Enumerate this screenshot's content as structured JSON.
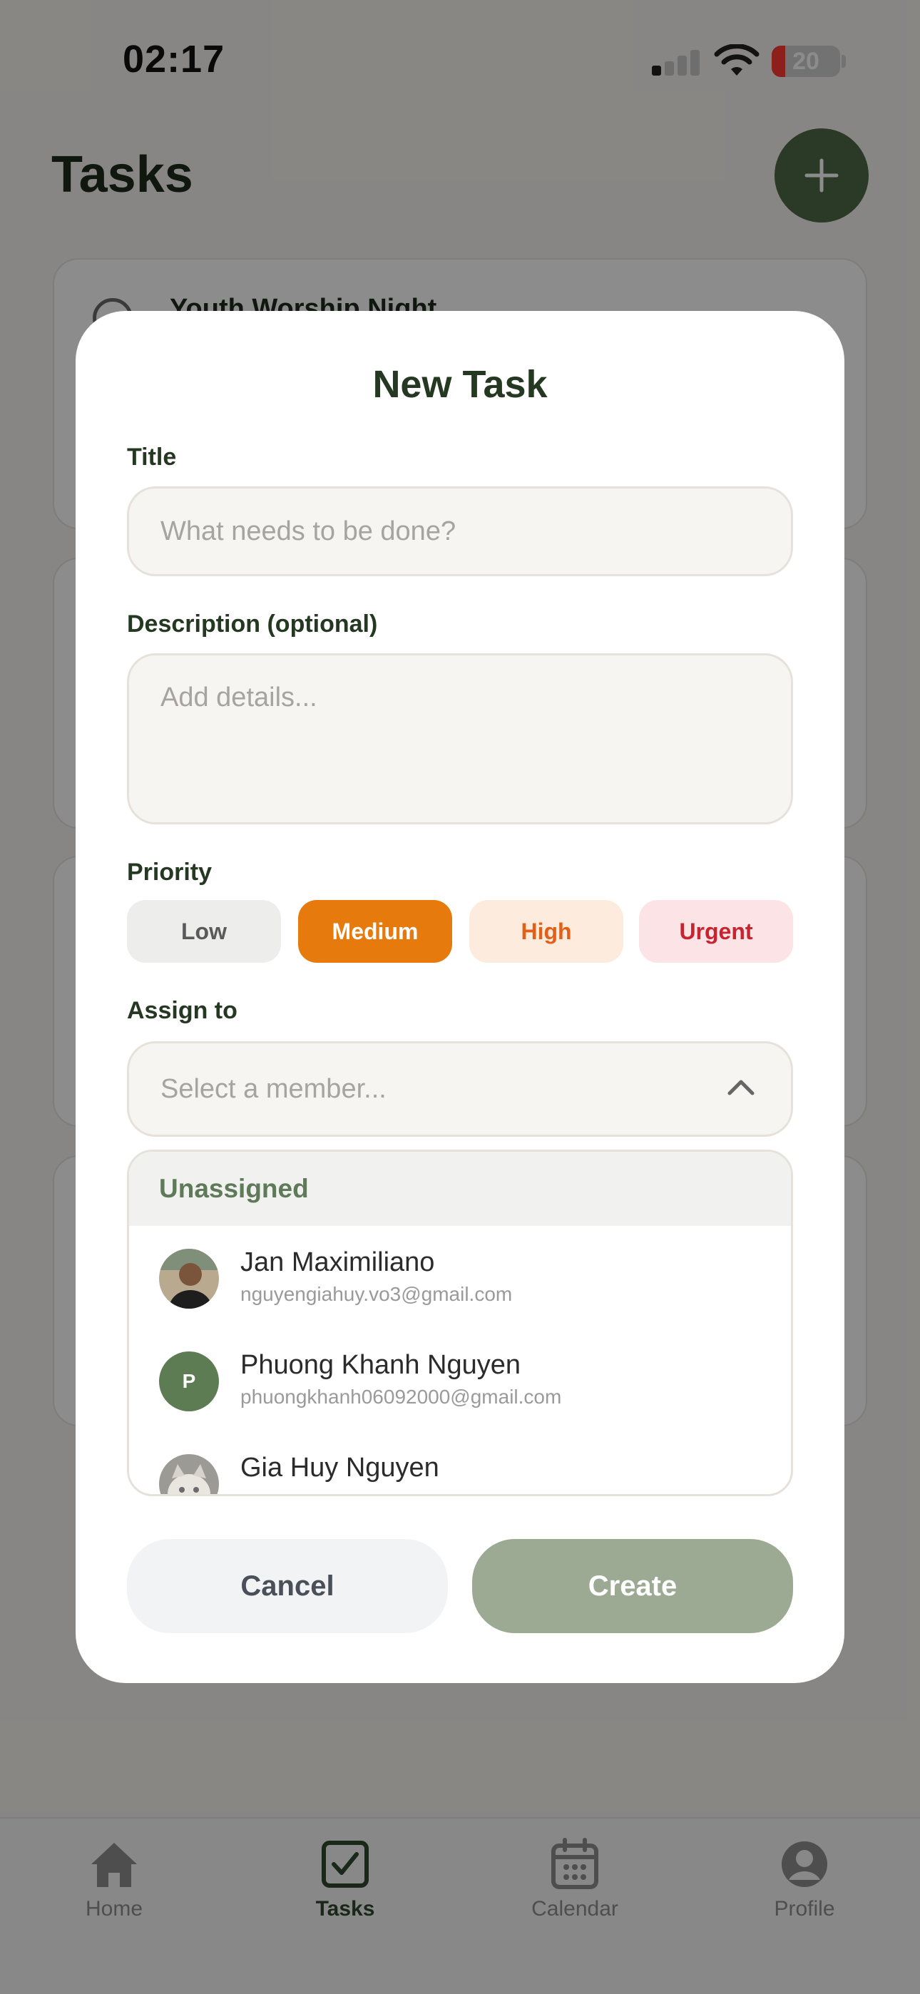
{
  "status_bar": {
    "time": "02:17",
    "battery": "20",
    "battery_level": 0.2
  },
  "header": {
    "title": "Tasks"
  },
  "background_tasks": [
    {
      "title": "Youth Worship Night"
    }
  ],
  "tab_bar": {
    "items": [
      {
        "label": "Home",
        "icon": "house-icon",
        "active": false
      },
      {
        "label": "Tasks",
        "icon": "checkbox-icon",
        "active": true
      },
      {
        "label": "Calendar",
        "icon": "calendar-icon",
        "active": false
      },
      {
        "label": "Profile",
        "icon": "person-icon",
        "active": false
      }
    ]
  },
  "modal": {
    "title": "New Task",
    "title_field": {
      "label": "Title",
      "placeholder": "What needs to be done?"
    },
    "description_field": {
      "label": "Description (optional)",
      "placeholder": "Add details..."
    },
    "priority": {
      "label": "Priority",
      "options": [
        "Low",
        "Medium",
        "High",
        "Urgent"
      ],
      "selected": "Medium"
    },
    "assign": {
      "label": "Assign to",
      "placeholder": "Select a member...",
      "dropdown_open": true,
      "unassigned_label": "Unassigned",
      "members": [
        {
          "name": "Jan Maximiliano",
          "email": "nguyengiahuy.vo3@gmail.com",
          "avatar": "photo"
        },
        {
          "name": "Phuong Khanh Nguyen",
          "email": "phuongkhanh06092000@gmail.com",
          "avatar": "P"
        },
        {
          "name": "Gia Huy Nguyen",
          "email": "",
          "avatar": "photo"
        }
      ]
    },
    "buttons": {
      "cancel": "Cancel",
      "create": "Create"
    }
  },
  "colors": {
    "brand_green": "#4d6a48",
    "medium_orange": "#e67a0c",
    "high_orange": "#e25f17",
    "urgent_red": "#c8242f",
    "create_disabled": "#9caa94"
  }
}
